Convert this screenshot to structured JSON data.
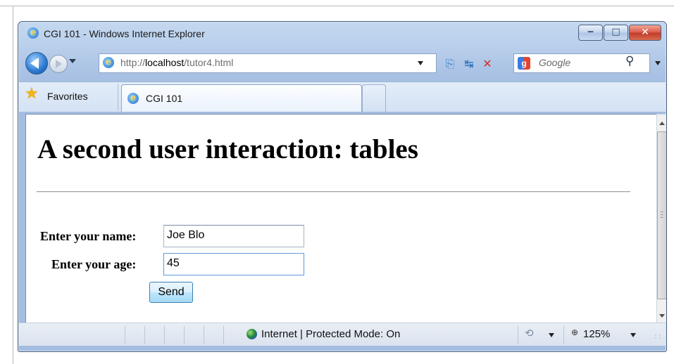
{
  "window": {
    "title": "CGI 101 - Windows Internet Explorer",
    "minimize_glyph": "‒",
    "maximize_glyph": "□",
    "close_glyph": "✕"
  },
  "navbar": {
    "url_prefix": "http://",
    "url_host": "localhost",
    "url_path": "/tutor4.html",
    "search_placeholder": "Google",
    "icons": [
      "back-icon",
      "forward-icon",
      "compatibility-view-icon",
      "refresh-icon",
      "stop-icon",
      "search-icon"
    ]
  },
  "favorites_bar": {
    "favorites_label": "Favorites",
    "tab_label": "CGI 101"
  },
  "page": {
    "heading": "A second user interaction: tables",
    "name_label": "Enter your name:",
    "name_value": "Joe Blo",
    "age_label": "Enter your age:",
    "age_value": "45",
    "send_label": "Send"
  },
  "statusbar": {
    "zone_text": "Internet | Protected Mode: On",
    "zoom_text": "125%"
  },
  "colors": {
    "chrome_blue": "#b9cfeb",
    "close_red": "#d9584a",
    "send_button": "#bee6fd"
  }
}
